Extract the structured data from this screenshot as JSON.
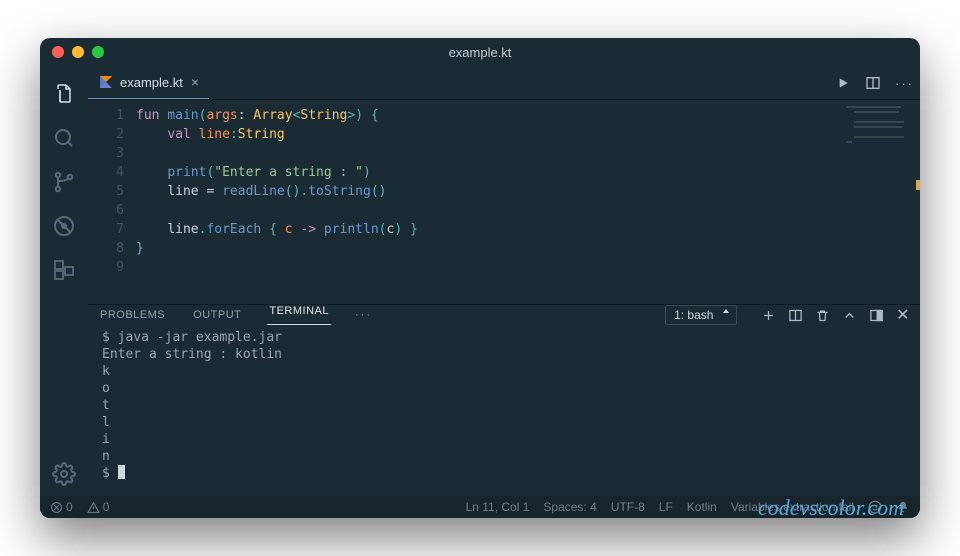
{
  "title": "example.kt",
  "tab": {
    "label": "example.kt"
  },
  "editor_actions": {
    "ellipsis": "···"
  },
  "panel": {
    "tabs": {
      "problems": "PROBLEMS",
      "output": "OUTPUT",
      "terminal": "TERMINAL"
    },
    "ellipsis": "···",
    "terminal_select": "1: bash"
  },
  "code": {
    "lines": [
      "1",
      "2",
      "3",
      "4",
      "5",
      "6",
      "7",
      "8",
      "9"
    ],
    "l1": {
      "fun": "fun",
      "main": "main",
      "lp": "(",
      "args": "args",
      "colon": ": ",
      "array": "Array",
      "lt": "<",
      "string": "String",
      "gt": ">",
      "rp": ")",
      "brace": " {"
    },
    "l2": {
      "indent": "    ",
      "val": "val",
      "sp": " ",
      "line": "line",
      "colon": ":",
      "string": "String"
    },
    "l3": "",
    "l4": {
      "indent": "    ",
      "print": "print",
      "lp": "(",
      "str": "\"Enter a string : \"",
      "rp": ")"
    },
    "l5": {
      "indent": "    ",
      "line": "line",
      "eq": " = ",
      "read": "readLine",
      "lp1": "(",
      "rp1": ")",
      "dot": ".",
      "tostr": "toString",
      "lp2": "(",
      "rp2": ")"
    },
    "l6": "",
    "l7": {
      "indent": "    ",
      "line": "line",
      "dot": ".",
      "foreach": "forEach",
      "sp": " ",
      "lb": "{",
      "sp2": " ",
      "c": "c",
      "arrow": " -> ",
      "println": "println",
      "lp": "(",
      "c2": "c",
      "rp": ")",
      "sp3": " ",
      "rb": "}"
    },
    "l8": {
      "brace": "}"
    }
  },
  "terminal": {
    "l1": "$ java -jar example.jar",
    "l2": "Enter a string : kotlin",
    "l3": "k",
    "l4": "o",
    "l5": "t",
    "l6": "l",
    "l7": "i",
    "l8": "n",
    "l9": "$ "
  },
  "status": {
    "errors": "0",
    "warnings": "0",
    "lncol": "Ln 11, Col 1",
    "spaces": "Spaces: 4",
    "encoding": "UTF-8",
    "eol": "LF",
    "lang": "Kotlin",
    "ext": "Variables extraction fail"
  },
  "watermark": "codevscolor.com"
}
